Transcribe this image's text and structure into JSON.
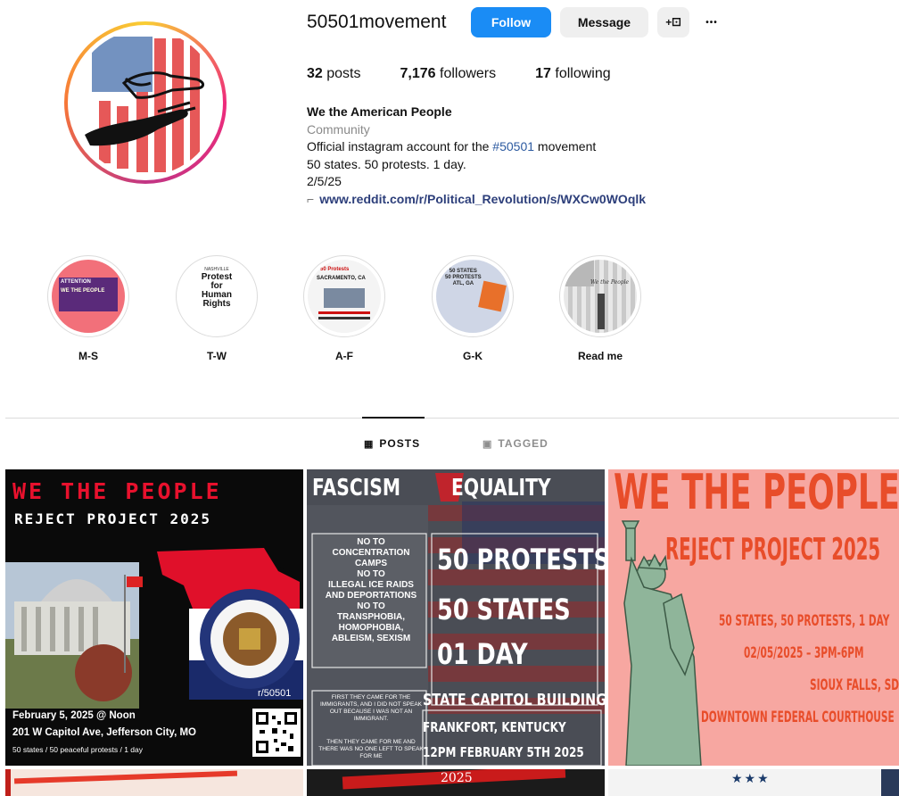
{
  "profile": {
    "username": "50501movement",
    "follow_label": "Follow",
    "message_label": "Message",
    "add_user_label": "+⚀",
    "more_label": "•••",
    "stats": {
      "posts_count": "32",
      "posts_label": "posts",
      "followers_count": "7,176",
      "followers_label": "followers",
      "following_count": "17",
      "following_label": "following"
    },
    "bio": {
      "name": "We the American People",
      "category": "Community",
      "line1_prefix": "Official instagram account for the ",
      "hashtag": "#50501",
      "line1_suffix": " movement",
      "line2": "50 states. 50 protests. 1 day.",
      "line3": "2/5/25",
      "link_icon": "⌐",
      "link": "www.reddit.com/r/Political_Revolution/s/WXCw0WOqlk"
    }
  },
  "highlights": [
    {
      "label": "M-S",
      "icon": "protest-flyer-red"
    },
    {
      "label": "T-W",
      "icon": "protest-for-human-rights-flyer"
    },
    {
      "label": "A-F",
      "icon": "sacramento-flyer"
    },
    {
      "label": "G-K",
      "icon": "atlanta-flyer"
    },
    {
      "label": "Read me",
      "icon": "statue-of-liberty-flag"
    }
  ],
  "highlight_thumbs": {
    "ms": {
      "line1": "ATTENTION",
      "line2": "WE THE PEOPLE"
    },
    "tw": {
      "top": "NASHVILLE",
      "line1": "Protest",
      "line2": "for",
      "line3": "Human",
      "line4": "Rights"
    },
    "af": {
      "top": "50 Protests",
      "line1": "SACRAMENTO, CA"
    },
    "gk": {
      "line1": "50 STATES",
      "line2": "50 PROTESTS",
      "line3": "ATL, GA"
    },
    "rm": {
      "line1": "We the People"
    }
  },
  "tabs": {
    "posts_icon": "▦",
    "posts": "POSTS",
    "tagged_icon": "▣",
    "tagged": "TAGGED"
  },
  "posts": {
    "p1": {
      "headline": "WE THE PEOPLE",
      "subhead": "REJECT PROJECT 2025",
      "hashtag": "r/50501",
      "caption1": "February 5, 2025 @ Noon",
      "caption2": "201 W Capitol Ave, Jefferson City, MO",
      "caption3": "50 states / 50 peaceful protests / 1 day"
    },
    "p2": {
      "left_title": "FASCISM",
      "right_title": "EQUALITY",
      "no_list": [
        "NO TO",
        "CONCENTRATION",
        "CAMPS",
        "NO TO",
        "ILLEGAL ICE RAIDS",
        "AND DEPORTATIONS",
        "NO TO",
        "TRANSPHOBIA,",
        "HOMOPHOBIA,",
        "ABLEISM, SEXISM"
      ],
      "big1": "50 PROTESTS",
      "big2": "50 STATES",
      "big3": "01 DAY",
      "small1": "FIRST THEY CAME FOR THE IMMIGRANTS, AND I DID NOT SPEAK OUT BECAUSE I WAS NOT AN IMMIGRANT.",
      "small2": "THEN THEY CAME FOR ME AND THERE WAS NO ONE LEFT TO SPEAK FOR ME",
      "foot1": "STATE CAPITOL BUILDING",
      "foot2": "FRANKFORT, KENTUCKY",
      "foot3": "12PM FEBRUARY 5TH 2025"
    },
    "p3": {
      "headline": "WE THE PEOPLE",
      "subhead": "REJECT PROJECT 2025",
      "line1": "50 STATES, 50 PROTESTS, 1 DAY",
      "line2": "02/05/2025 – 3PM-6PM",
      "line3": "SIOUX FALLS, SD",
      "line4": "DOWNTOWN FEDERAL COURTHOUSE"
    },
    "p5": {
      "headline": "2025"
    }
  },
  "colors": {
    "follow_blue": "#1a8cf5",
    "accent_red": "#e8112d",
    "poster_orange": "#e84d2a"
  }
}
